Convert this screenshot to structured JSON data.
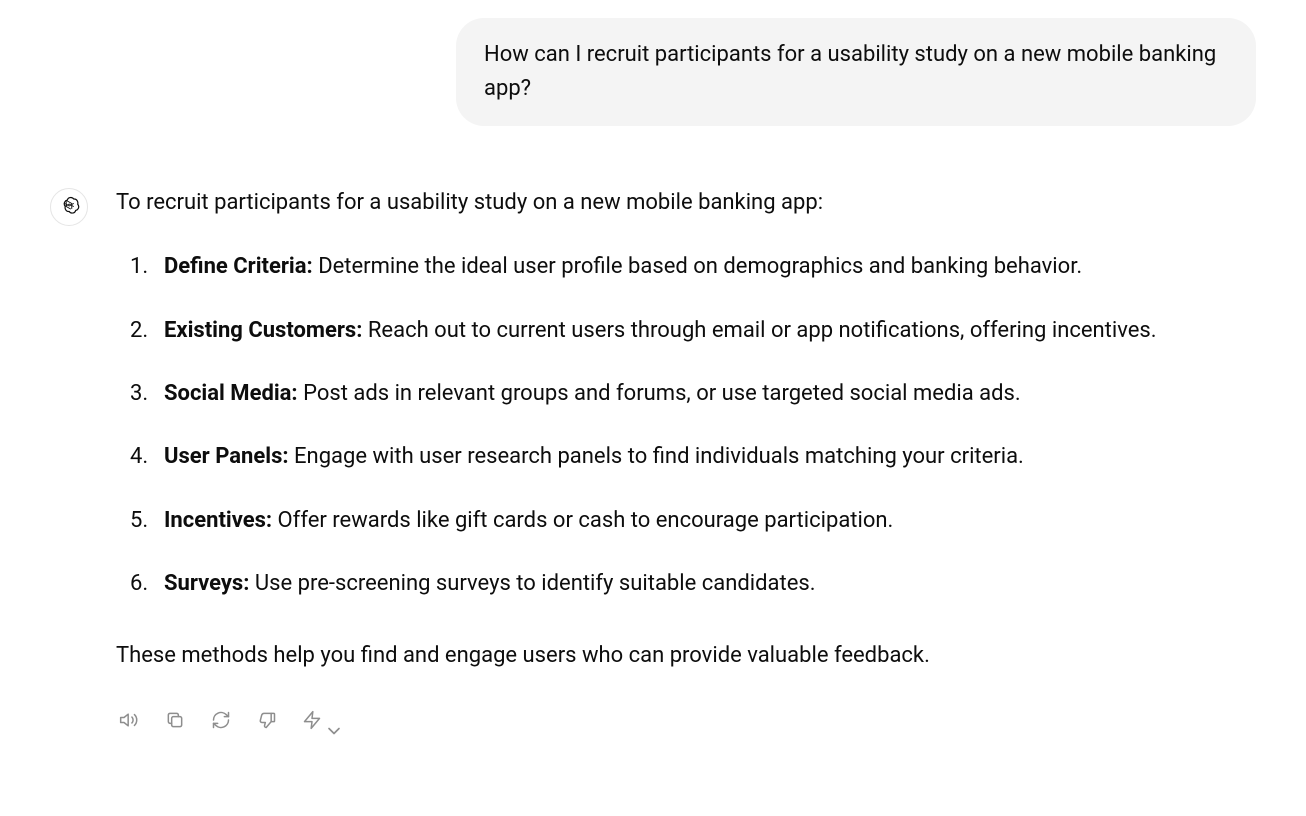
{
  "user_message": "How can I recruit participants for a usability study on a new mobile banking app?",
  "assistant": {
    "intro": "To recruit participants for a usability study on a new mobile banking app:",
    "steps": [
      {
        "term": "Define Criteria:",
        "desc": " Determine the ideal user profile based on demographics and banking behavior."
      },
      {
        "term": "Existing Customers:",
        "desc": " Reach out to current users through email or app notifications, offering incentives."
      },
      {
        "term": "Social Media:",
        "desc": " Post ads in relevant groups and forums, or use targeted social media ads."
      },
      {
        "term": "User Panels:",
        "desc": " Engage with user research panels to find individuals matching your criteria."
      },
      {
        "term": "Incentives:",
        "desc": " Offer rewards like gift cards or cash to encourage participation."
      },
      {
        "term": "Surveys:",
        "desc": " Use pre-screening surveys to identify suitable candidates."
      }
    ],
    "closing": "These methods help you find and engage users who can provide valuable feedback."
  },
  "actions": {
    "speak": "speak-aloud",
    "copy": "copy",
    "regenerate": "regenerate",
    "dislike": "dislike",
    "model": "model-switch"
  }
}
